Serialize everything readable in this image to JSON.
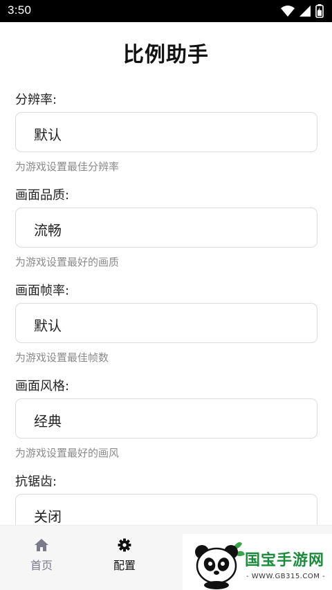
{
  "status": {
    "time": "3:50"
  },
  "title": "比例助手",
  "settings": [
    {
      "label": "分辨率:",
      "value": "默认",
      "hint": "为游戏设置最佳分辨率"
    },
    {
      "label": "画面品质:",
      "value": "流畅",
      "hint": "为游戏设置最好的画质"
    },
    {
      "label": "画面帧率:",
      "value": "默认",
      "hint": "为游戏设置最佳帧数"
    },
    {
      "label": "画面风格:",
      "value": "经典",
      "hint": "为游戏设置最好的画风"
    },
    {
      "label": "抗锯齿:",
      "value": "关闭"
    }
  ],
  "nav": {
    "home": {
      "label": "首页",
      "icon": "home-icon"
    },
    "config": {
      "label": "配置",
      "icon": "gear-icon"
    }
  },
  "watermark": {
    "text": "国宝手游网",
    "url": "- WWW.GB315.COM -"
  },
  "colors": {
    "nav_inactive": "#7a7a8c",
    "hint": "#8a8a8a",
    "watermark_green": "#1b8c3a"
  }
}
